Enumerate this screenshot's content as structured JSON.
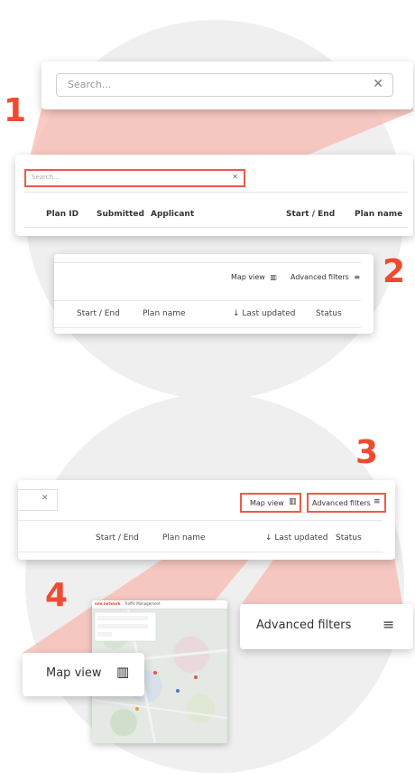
{
  "step1": {
    "number": "1",
    "search_zoom": {
      "placeholder": "Search...",
      "clear_icon": "close-icon"
    },
    "table": {
      "search_placeholder": "Search...",
      "columns": [
        "Plan ID",
        "Submitted",
        "Applicant",
        "Start / End",
        "Plan name"
      ]
    }
  },
  "step2": {
    "number": "2",
    "map_view_label": "Map view",
    "advanced_filters_label": "Advanced filters",
    "columns": [
      "Start / End",
      "Plan name",
      "Last updated",
      "Status"
    ]
  },
  "step3": {
    "number": "3",
    "map_view_label": "Map view",
    "advanced_filters_label": "Advanced filters",
    "columns": [
      "Start / End",
      "Plan name",
      "Last updated",
      "Status"
    ]
  },
  "step4": {
    "number": "4",
    "map_view_label": "Map view",
    "advanced_filters_label": "Advanced filters",
    "map_preview": {
      "brand": "one.network",
      "tab": "Traffic Management"
    }
  },
  "colors": {
    "accent": "#f04a2f",
    "highlight_border": "#ef5a48",
    "highlight_fill": "#f8b9b0"
  }
}
